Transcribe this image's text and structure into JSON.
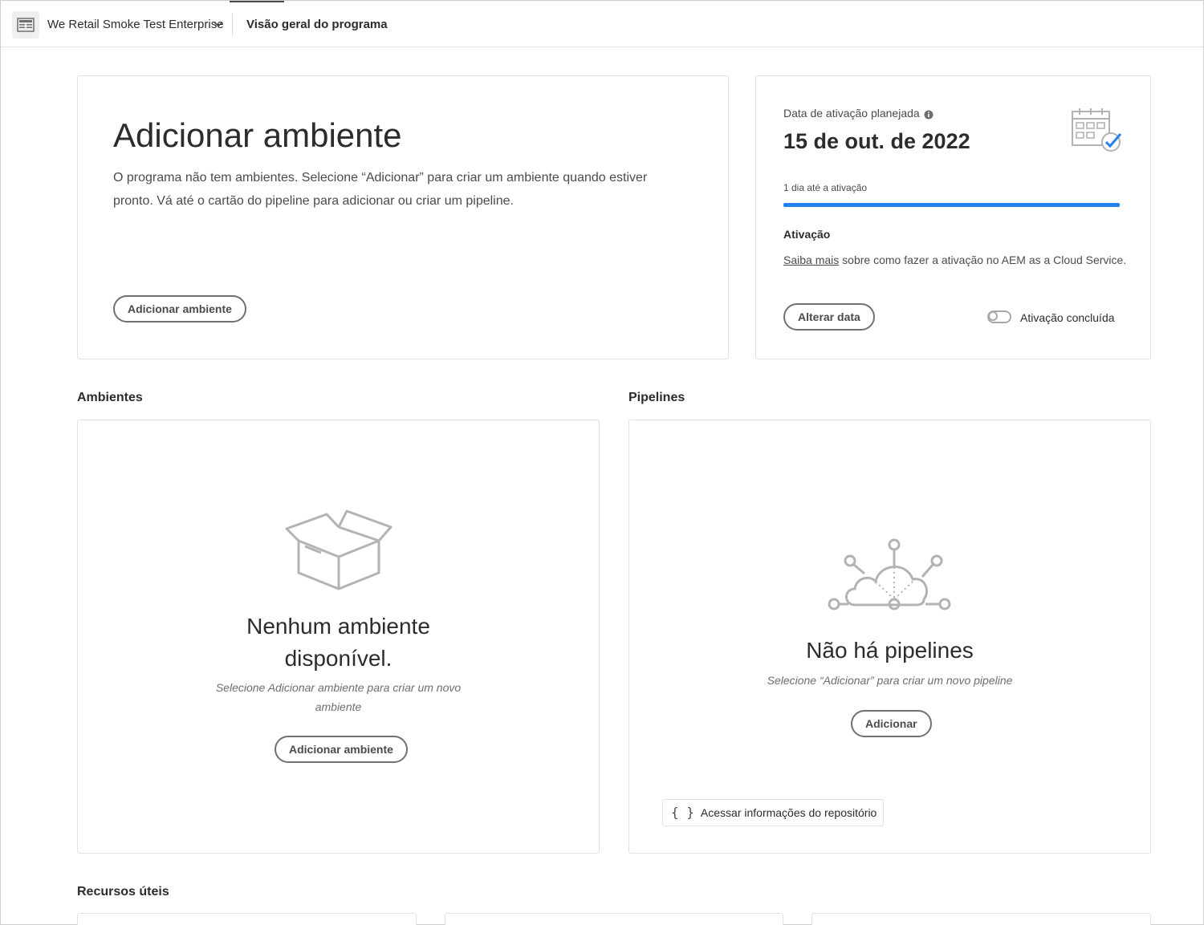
{
  "header": {
    "program_name": "We Retail Smoke Test Enterprise",
    "page_tab": "Visão geral do programa"
  },
  "hero": {
    "title": "Adicionar ambiente",
    "description": "O programa não tem ambientes. Selecione “Adicionar” para criar um ambiente quando estiver pronto. Vá até o cartão do pipeline para adicionar ou criar um pipeline.",
    "button_label": "Adicionar ambiente"
  },
  "activation": {
    "label": "Data de ativação planejada",
    "date": "15 de out. de 2022",
    "progress_label": "1 dia até a ativação",
    "progress_fraction": 1.0,
    "section_title": "Ativação",
    "link_text": "Saiba mais",
    "text_rest": " sobre como fazer a ativação no AEM as a Cloud Service.",
    "change_date_label": "Alterar data",
    "toggle_label": "Ativação concluída",
    "toggle_on": false
  },
  "environments": {
    "heading": "Ambientes",
    "empty_title_line1": "Nenhum ambiente",
    "empty_title_line2": "disponível.",
    "empty_subtitle_line1": "Selecione Adicionar ambiente para criar um novo",
    "empty_subtitle_line2": "ambiente",
    "button_label": "Adicionar ambiente"
  },
  "pipelines": {
    "heading": "Pipelines",
    "empty_title": "Não há pipelines",
    "empty_subtitle": "Selecione “Adicionar” para criar um novo pipeline",
    "button_label": "Adicionar",
    "repo_button_icon": "{ }",
    "repo_button_label": "Acessar informações do repositório"
  },
  "resources": {
    "heading": "Recursos úteis"
  },
  "colors": {
    "accent": "#2680eb",
    "border": "#e1e1e1",
    "illustration": "#b3b3b3"
  }
}
